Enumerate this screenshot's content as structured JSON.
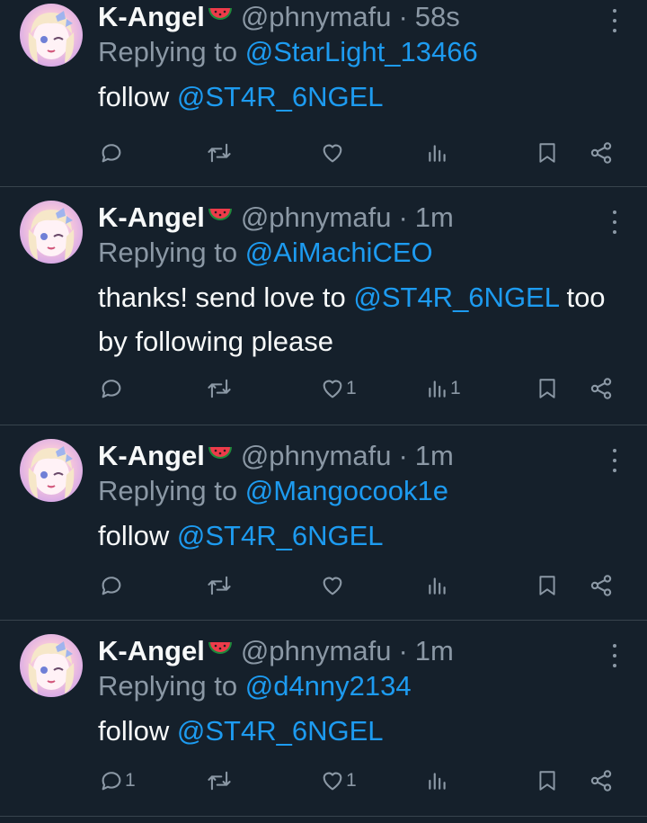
{
  "tweets": [
    {
      "author": {
        "name": "K-Angel",
        "handle": "@phnymafu",
        "emoji": "watermelon-icon"
      },
      "time": "58s",
      "replying_prefix": "Replying to",
      "replying_to": "@StarLight_13466",
      "text_before": "follow",
      "mention": "@ST4R_6NGEL",
      "text_after": "",
      "stats": {
        "replies": "",
        "reposts": "",
        "likes": "",
        "views": ""
      }
    },
    {
      "author": {
        "name": "K-Angel",
        "handle": "@phnymafu",
        "emoji": "watermelon-icon"
      },
      "time": "1m",
      "replying_prefix": "Replying to",
      "replying_to": "@AiMachiCEO",
      "text_before": "thanks! send love to",
      "mention": "@ST4R_6NGEL",
      "text_after": "too by following please",
      "stats": {
        "replies": "",
        "reposts": "",
        "likes": "1",
        "views": "1"
      }
    },
    {
      "author": {
        "name": "K-Angel",
        "handle": "@phnymafu",
        "emoji": "watermelon-icon"
      },
      "time": "1m",
      "replying_prefix": "Replying to",
      "replying_to": "@Mangocook1e",
      "text_before": "follow",
      "mention": "@ST4R_6NGEL",
      "text_after": "",
      "stats": {
        "replies": "",
        "reposts": "",
        "likes": "",
        "views": ""
      }
    },
    {
      "author": {
        "name": "K-Angel",
        "handle": "@phnymafu",
        "emoji": "watermelon-icon"
      },
      "time": "1m",
      "replying_prefix": "Replying to",
      "replying_to": "@d4nny2134",
      "text_before": "follow",
      "mention": "@ST4R_6NGEL",
      "text_after": "",
      "stats": {
        "replies": "1",
        "reposts": "",
        "likes": "1",
        "views": ""
      }
    }
  ],
  "colors": {
    "background": "#15202b",
    "link": "#1d9bf0",
    "muted": "#8b98a5",
    "text": "#f7f9f9",
    "divider": "#38444d"
  }
}
